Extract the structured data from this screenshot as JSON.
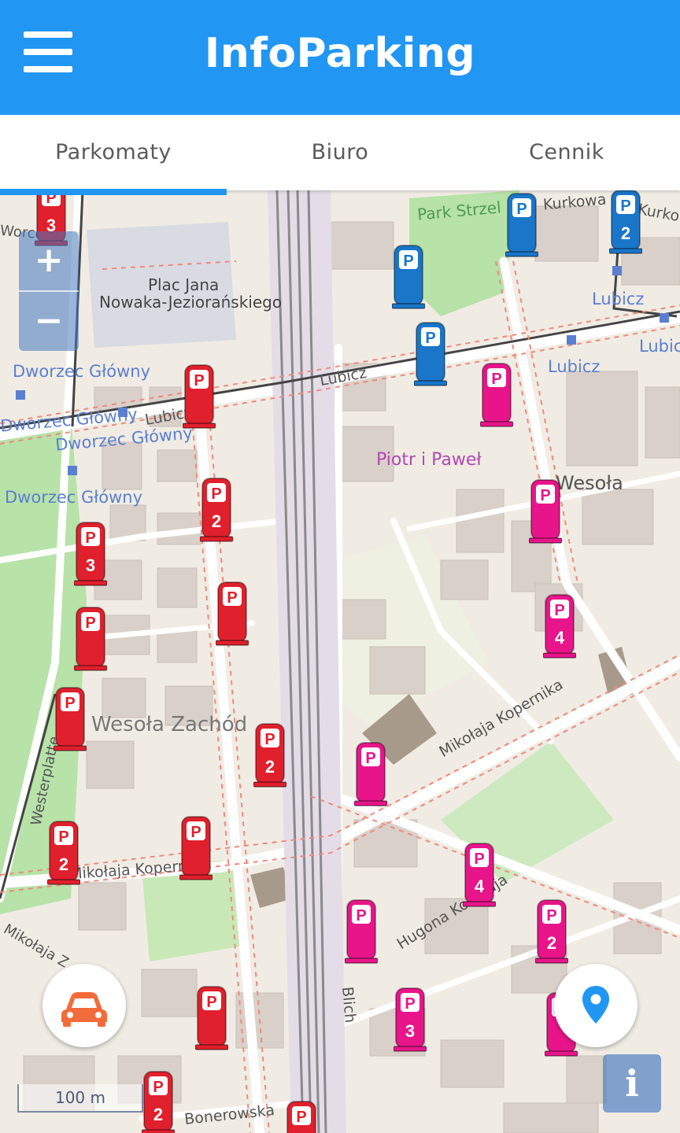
{
  "app": {
    "title": "InfoParking"
  },
  "tabs": [
    {
      "label": "Parkomaty",
      "active": true
    },
    {
      "label": "Biuro",
      "active": false
    },
    {
      "label": "Cennik",
      "active": false
    }
  ],
  "colors": {
    "primary": "#2196f3",
    "meter_red": "#e0202c",
    "meter_pink": "#e8158a",
    "meter_blue": "#1976c8"
  },
  "map": {
    "zoom_in_label": "+",
    "zoom_out_label": "−",
    "scale_label": "100 m",
    "info_label": "i",
    "labels": [
      "Park Strzel",
      "Kurkowa",
      "Kurkowa",
      "Plac Jana",
      "Nowaka-Jeziorańskiego",
      "Lubicz",
      "Lubicz",
      "Lubicz",
      "Lubicz",
      "Lubicz",
      "Dworzec Główny",
      "Dworzec Główny",
      "Dworzec Główny",
      "Dworzec Główny",
      "Piotr i Paweł",
      "Wesoła",
      "Wesoła Zachód",
      "Mikołaja Kopernika",
      "Mikołaja Kopernika",
      "Hugona Kołłątaja",
      "Blich",
      "Bonerowska",
      "Westerplatte",
      "Worcella",
      "Mikołaja Z"
    ],
    "meters": [
      {
        "color": "red",
        "number": "3"
      },
      {
        "color": "blue",
        "number": ""
      },
      {
        "color": "blue",
        "number": "2"
      },
      {
        "color": "blue",
        "number": ""
      },
      {
        "color": "blue",
        "number": ""
      },
      {
        "color": "red",
        "number": ""
      },
      {
        "color": "pink",
        "number": ""
      },
      {
        "color": "red",
        "number": "2"
      },
      {
        "color": "red",
        "number": "3"
      },
      {
        "color": "pink",
        "number": ""
      },
      {
        "color": "red",
        "number": ""
      },
      {
        "color": "red",
        "number": ""
      },
      {
        "color": "pink",
        "number": "4"
      },
      {
        "color": "red",
        "number": ""
      },
      {
        "color": "red",
        "number": "2"
      },
      {
        "color": "pink",
        "number": ""
      },
      {
        "color": "red",
        "number": "2"
      },
      {
        "color": "red",
        "number": ""
      },
      {
        "color": "pink",
        "number": "4"
      },
      {
        "color": "pink",
        "number": ""
      },
      {
        "color": "pink",
        "number": "2"
      },
      {
        "color": "red",
        "number": ""
      },
      {
        "color": "pink",
        "number": "3"
      },
      {
        "color": "pink",
        "number": ""
      },
      {
        "color": "red",
        "number": "2"
      },
      {
        "color": "red",
        "number": ""
      }
    ]
  },
  "actions": {
    "car_icon": "car-icon",
    "locate_icon": "location-pin-icon"
  }
}
